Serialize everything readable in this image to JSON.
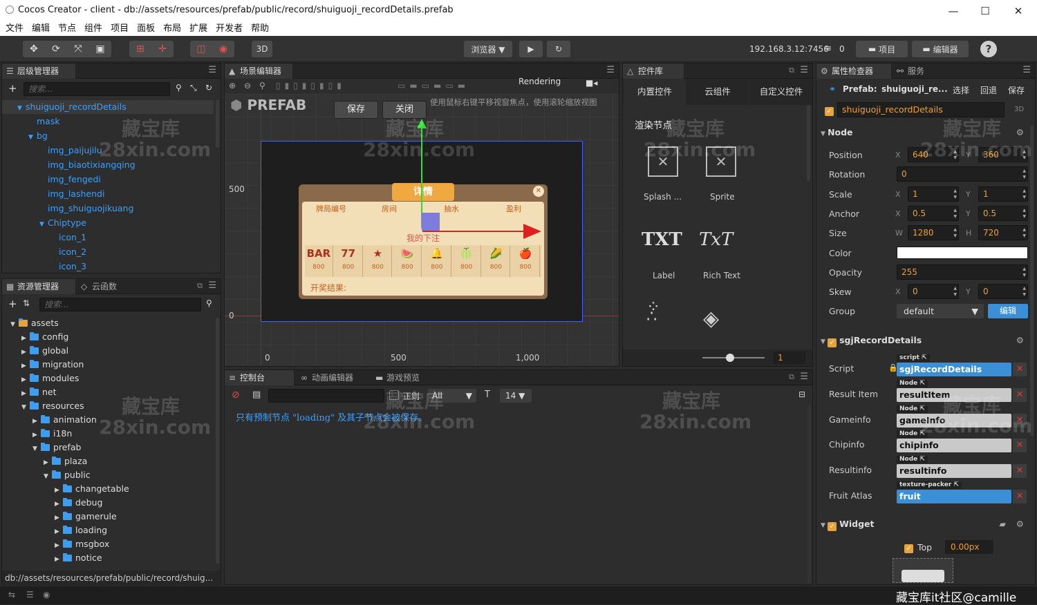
{
  "window": {
    "title": "Cocos Creator - client - db://assets/resources/prefab/public/record/shuiguoji_recordDetails.prefab",
    "minimize": "—",
    "maximize": "☐",
    "close": "✕"
  },
  "menu": [
    "文件",
    "编辑",
    "节点",
    "组件",
    "项目",
    "面板",
    "布局",
    "扩展",
    "开发者",
    "帮助"
  ],
  "toolbar": {
    "mode_3d": "3D",
    "browser": "浏览器 ▼",
    "ip": "192.168.3.12:7456",
    "devices": "0",
    "project_btn": "项目",
    "editor_btn": "编辑器",
    "help": "?"
  },
  "hierarchy": {
    "title": "层级管理器",
    "search_placeholder": "搜索...",
    "nodes": [
      {
        "label": "shuiguoji_recordDetails",
        "depth": 0,
        "arrow": "▼",
        "selected": true
      },
      {
        "label": "mask",
        "depth": 1,
        "arrow": ""
      },
      {
        "label": "bg",
        "depth": 1,
        "arrow": "▼"
      },
      {
        "label": "img_paijujilu",
        "depth": 2,
        "arrow": ""
      },
      {
        "label": "img_biaotixiangqing",
        "depth": 2,
        "arrow": ""
      },
      {
        "label": "img_fengedi",
        "depth": 2,
        "arrow": ""
      },
      {
        "label": "img_lashendi",
        "depth": 2,
        "arrow": ""
      },
      {
        "label": "img_shuiguojikuang",
        "depth": 2,
        "arrow": ""
      },
      {
        "label": "Chiptype",
        "depth": 2,
        "arrow": "▼"
      },
      {
        "label": "icon_1",
        "depth": 3,
        "arrow": ""
      },
      {
        "label": "icon_2",
        "depth": 3,
        "arrow": ""
      },
      {
        "label": "icon_3",
        "depth": 3,
        "arrow": ""
      }
    ]
  },
  "assets": {
    "title": "资源管理器",
    "tab2": "云函数",
    "search_placeholder": "搜索...",
    "items": [
      {
        "label": "assets",
        "depth": 0,
        "arrow": "▼",
        "root": true
      },
      {
        "label": "config",
        "depth": 1,
        "arrow": "▶"
      },
      {
        "label": "global",
        "depth": 1,
        "arrow": "▶"
      },
      {
        "label": "migration",
        "depth": 1,
        "arrow": "▶"
      },
      {
        "label": "modules",
        "depth": 1,
        "arrow": "▶"
      },
      {
        "label": "net",
        "depth": 1,
        "arrow": "▶"
      },
      {
        "label": "resources",
        "depth": 1,
        "arrow": "▼"
      },
      {
        "label": "animation",
        "depth": 2,
        "arrow": "▶"
      },
      {
        "label": "i18n",
        "depth": 2,
        "arrow": "▶"
      },
      {
        "label": "prefab",
        "depth": 2,
        "arrow": "▼"
      },
      {
        "label": "plaza",
        "depth": 3,
        "arrow": "▶"
      },
      {
        "label": "public",
        "depth": 3,
        "arrow": "▼"
      },
      {
        "label": "changetable",
        "depth": 4,
        "arrow": "▶"
      },
      {
        "label": "debug",
        "depth": 4,
        "arrow": "▶"
      },
      {
        "label": "gamerule",
        "depth": 4,
        "arrow": "▶"
      },
      {
        "label": "loading",
        "depth": 4,
        "arrow": "▶"
      },
      {
        "label": "msgbox",
        "depth": 4,
        "arrow": "▶"
      },
      {
        "label": "notice",
        "depth": 4,
        "arrow": "▶"
      }
    ],
    "path": "db://assets/resources/prefab/public/record/shuig..."
  },
  "scene": {
    "title": "场景编辑器",
    "rendering": "Rendering",
    "prefab_label": "PREFAB",
    "save_btn": "保存",
    "close_btn": "关闭",
    "hint": "使用鼠标右键平移视窗焦点，使用滚轮缩放视图",
    "axis": {
      "y500": "500",
      "y0": "0",
      "x0": "0",
      "x500": "500",
      "x1000": "1,000"
    },
    "dialog": {
      "title": "详情",
      "headers": [
        "牌局编号",
        "房间",
        "抽水",
        "盈利"
      ],
      "my_bet": "我的下注",
      "bets": [
        {
          "icon": "BAR",
          "value": "800"
        },
        {
          "icon": "77",
          "value": "800"
        },
        {
          "icon": "★",
          "value": "800"
        },
        {
          "icon": "🍉",
          "value": "800"
        },
        {
          "icon": "🔔",
          "value": "800"
        },
        {
          "icon": "🍈",
          "value": "800"
        },
        {
          "icon": "🌽",
          "value": "800"
        },
        {
          "icon": "🍎",
          "value": "800"
        }
      ],
      "result_label": "开奖结果:"
    }
  },
  "widgets": {
    "title": "控件库",
    "tabs": [
      "内置控件",
      "云组件",
      "自定义控件"
    ],
    "section": "渲染节点",
    "items": [
      {
        "label": "Splash ...",
        "glyph": "⊡"
      },
      {
        "label": "Sprite",
        "glyph": "⊡"
      },
      {
        "label": "Label",
        "glyph": "TXT"
      },
      {
        "label": "Rich Text",
        "glyph": "TxT"
      }
    ],
    "slider_value": "1"
  },
  "console": {
    "tabs": [
      "控制台",
      "动画编辑器",
      "游戏预览"
    ],
    "regex": "正则",
    "filter": "All",
    "font_size": "14 ▼",
    "message": "只有预制节点 \"loading\" 及其子节点会被保存。"
  },
  "inspector": {
    "title": "属性检查器",
    "tab2": "服务",
    "prefab_label": "Prefab:",
    "prefab_name": "shuiguoji_re...",
    "actions": [
      "选择",
      "回退",
      "保存"
    ],
    "node_name": "shuiguoji_recordDetails",
    "mode_3d": "3D",
    "node_section": "Node",
    "props": [
      {
        "label": "Position",
        "a_label": "X",
        "a": "640",
        "b_label": "Y",
        "b": "360"
      },
      {
        "label": "Rotation",
        "single": "0"
      },
      {
        "label": "Scale",
        "a_label": "X",
        "a": "1",
        "b_label": "Y",
        "b": "1"
      },
      {
        "label": "Anchor",
        "a_label": "X",
        "a": "0.5",
        "b_label": "Y",
        "b": "0.5"
      },
      {
        "label": "Size",
        "a_label": "W",
        "a": "1280",
        "b_label": "H",
        "b": "720"
      },
      {
        "label": "Color",
        "color": "#ffffff"
      },
      {
        "label": "Opacity",
        "single": "255"
      },
      {
        "label": "Skew",
        "a_label": "X",
        "a": "0",
        "b_label": "Y",
        "b": "0"
      },
      {
        "label": "Group",
        "select": "default",
        "button": "编辑"
      }
    ],
    "component": "sgjRecordDetails",
    "fields": [
      {
        "label": "Script",
        "tag": "script",
        "value": "sgjRecordDetails",
        "kind": "asset"
      },
      {
        "label": "Result Item",
        "tag": "Node",
        "value": "resultItem",
        "kind": "node"
      },
      {
        "label": "Gameinfo",
        "tag": "Node",
        "value": "gameInfo",
        "kind": "node"
      },
      {
        "label": "Chipinfo",
        "tag": "Node",
        "value": "chipinfo",
        "kind": "node"
      },
      {
        "label": "Resultinfo",
        "tag": "Node",
        "value": "resultinfo",
        "kind": "node"
      },
      {
        "label": "Fruit Atlas",
        "tag": "texture-packer",
        "value": "fruit",
        "kind": "asset"
      }
    ],
    "widget_section": "Widget",
    "widget_top_label": "Top",
    "widget_top_value": "0.00px"
  },
  "watermark": {
    "line1": "藏宝库",
    "line2": "28xin.com"
  },
  "footer_watermark": "藏宝库it社区@camille",
  "colors": {
    "accent": "#3aa0ff",
    "orange": "#e8a33b",
    "red_close": "#e03a3a",
    "node_field": "#c9c9c9",
    "asset_field": "#3a8fd6"
  }
}
